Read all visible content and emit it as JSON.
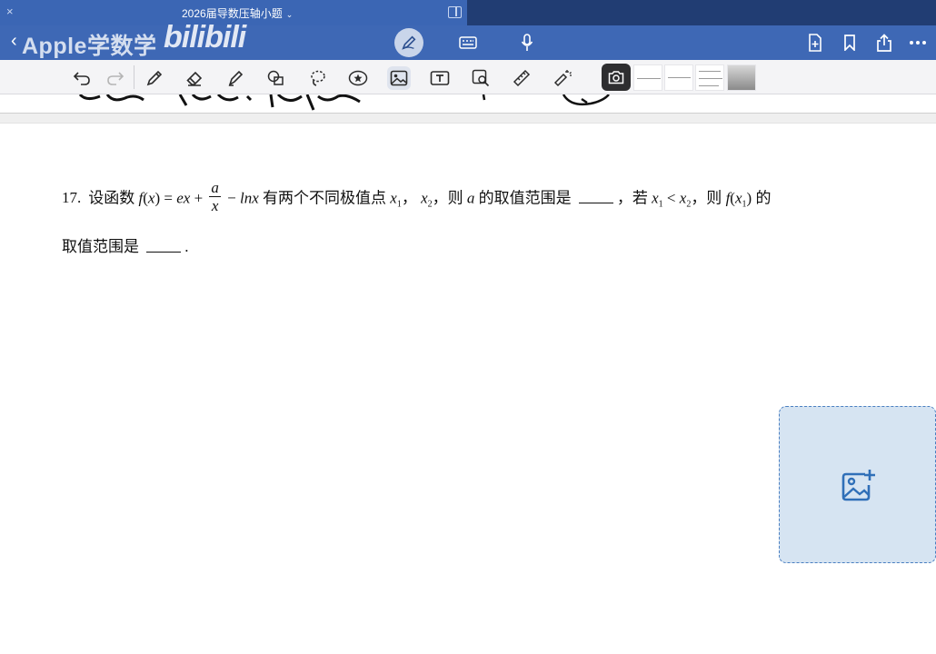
{
  "topbar": {
    "close_icon": "×",
    "title": "2026届导数压轴小题",
    "title_chevron": "⌄"
  },
  "navbar": {
    "back_icon": "‹",
    "watermark": "Apple学数学",
    "bili_logo": "bilibili"
  },
  "problem": {
    "number": "17.",
    "intro": "设函数",
    "func_f": "f",
    "func_open": "(",
    "func_var": "x",
    "func_close": ")",
    "eq": " = ",
    "term_ex": "ex",
    "plus": " + ",
    "frac_num": "a",
    "frac_den": "x",
    "minus": " − ",
    "term_lnx": "lnx",
    "text_a": " 有两个不同极值点 ",
    "x": "x",
    "sub1": "1",
    "comma1": "，",
    "sub2": "2",
    "text_b": "，则 ",
    "var_a": "a",
    "text_c": " 的取值范围是 ",
    "text_d": "，若 ",
    "lt": " < ",
    "text_e": "，则 ",
    "text_f": " 的",
    "line2_text": "取值范围是 ",
    "period": "."
  },
  "colors": {
    "topbar": "#3b66b4",
    "navbar": "#3e68b5",
    "dropbox": "#d6e4f2",
    "dropbox_border": "#4a7fc1"
  }
}
